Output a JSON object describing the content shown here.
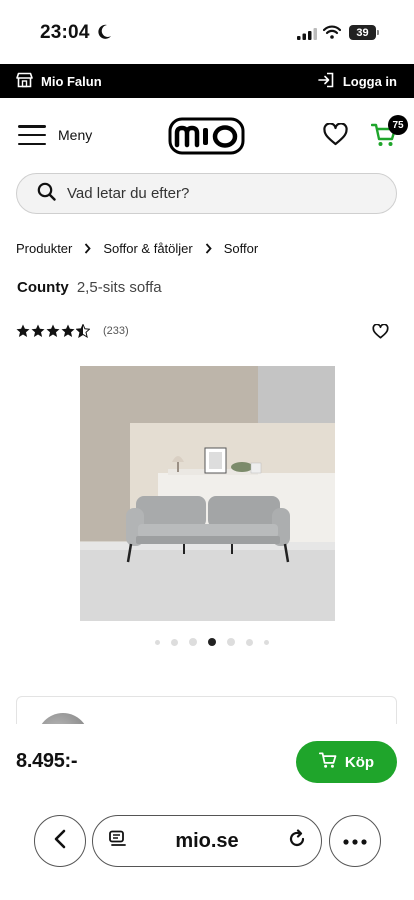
{
  "status_bar": {
    "time": "23:04",
    "battery": "39"
  },
  "store_bar": {
    "store_name": "Mio Falun",
    "login_label": "Logga in"
  },
  "header": {
    "menu_label": "Meny",
    "logo": "mio",
    "cart_count": "75"
  },
  "search": {
    "placeholder": "Vad letar du efter?"
  },
  "breadcrumb": [
    "Produkter",
    "Soffor & fåtöljer",
    "Soffor"
  ],
  "product": {
    "brand": "County",
    "name": "2,5-sits soffa",
    "rating": 4.5,
    "review_count": "(233)",
    "price": "8.495:-",
    "buy_label": "Köp",
    "image_count": 7,
    "active_image": 4
  },
  "browser": {
    "url": "mio.se"
  },
  "colors": {
    "buy_green": "#1fa52b",
    "store_bar": "#000000"
  },
  "icons": [
    "moon-icon",
    "signal-icon",
    "wifi-icon",
    "store-icon",
    "login-icon",
    "hamburger-icon",
    "heart-icon",
    "cart-icon",
    "search-icon",
    "chevron-right-icon",
    "star-icon",
    "chevron-left-icon",
    "reader-icon",
    "reload-icon",
    "more-icon"
  ]
}
